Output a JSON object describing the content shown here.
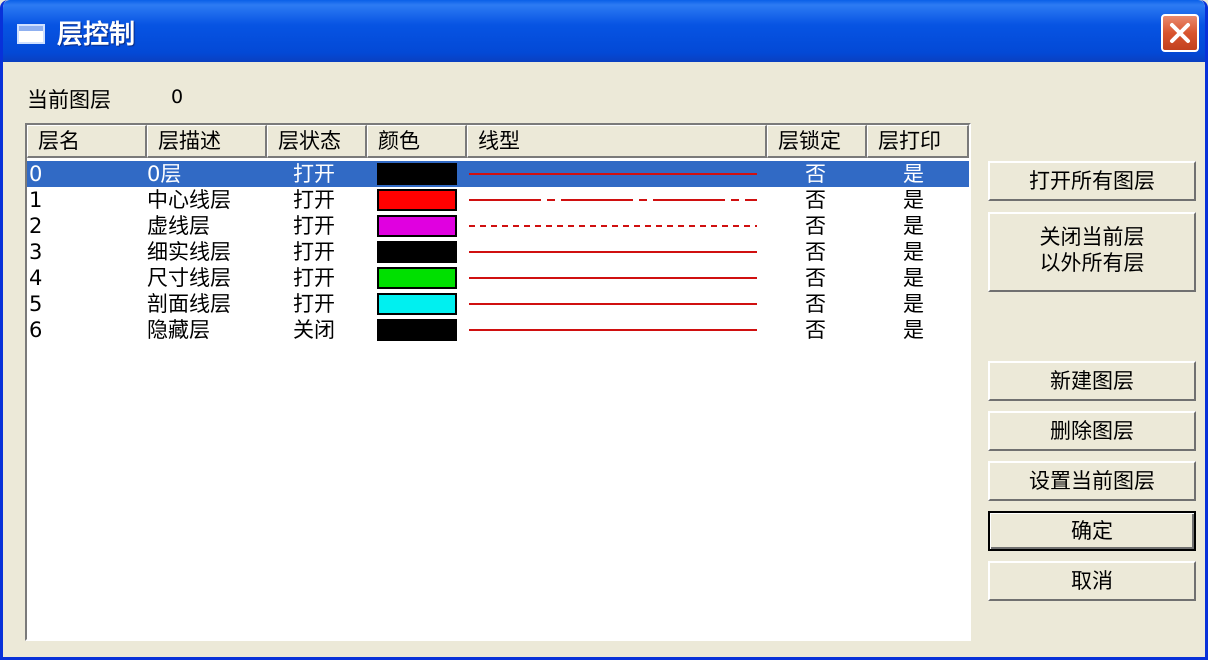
{
  "window": {
    "title": "层控制"
  },
  "current_layer": {
    "label": "当前图层",
    "value": "0"
  },
  "columns": [
    "层名",
    "层描述",
    "层状态",
    "颜色",
    "线型",
    "层锁定",
    "层打印"
  ],
  "layers": [
    {
      "name": "0",
      "desc": "0层",
      "status": "打开",
      "color": "#000000",
      "linetype": "solid",
      "locked": "否",
      "print": "是",
      "selected": true
    },
    {
      "name": "1",
      "desc": "中心线层",
      "status": "打开",
      "color": "#ff0000",
      "linetype": "dashdot",
      "locked": "否",
      "print": "是",
      "selected": false
    },
    {
      "name": "2",
      "desc": "虚线层",
      "status": "打开",
      "color": "#e000e0",
      "linetype": "dashed",
      "locked": "否",
      "print": "是",
      "selected": false
    },
    {
      "name": "3",
      "desc": "细实线层",
      "status": "打开",
      "color": "#000000",
      "linetype": "solid",
      "locked": "否",
      "print": "是",
      "selected": false
    },
    {
      "name": "4",
      "desc": "尺寸线层",
      "status": "打开",
      "color": "#00e000",
      "linetype": "solid",
      "locked": "否",
      "print": "是",
      "selected": false
    },
    {
      "name": "5",
      "desc": "剖面线层",
      "status": "打开",
      "color": "#00f0f0",
      "linetype": "solid",
      "locked": "否",
      "print": "是",
      "selected": false
    },
    {
      "name": "6",
      "desc": "隐藏层",
      "status": "关闭",
      "color": "#000000",
      "linetype": "solid",
      "locked": "否",
      "print": "是",
      "selected": false
    }
  ],
  "buttons": {
    "open_all": "打开所有图层",
    "close_others_line1": "关闭当前层",
    "close_others_line2": "以外所有层",
    "new_layer": "新建图层",
    "delete_layer": "删除图层",
    "set_current": "设置当前图层",
    "ok": "确定",
    "cancel": "取消"
  },
  "colors": {
    "line_red": "#d01010",
    "selection": "#316ac5",
    "titlebar": "#0754e3"
  }
}
